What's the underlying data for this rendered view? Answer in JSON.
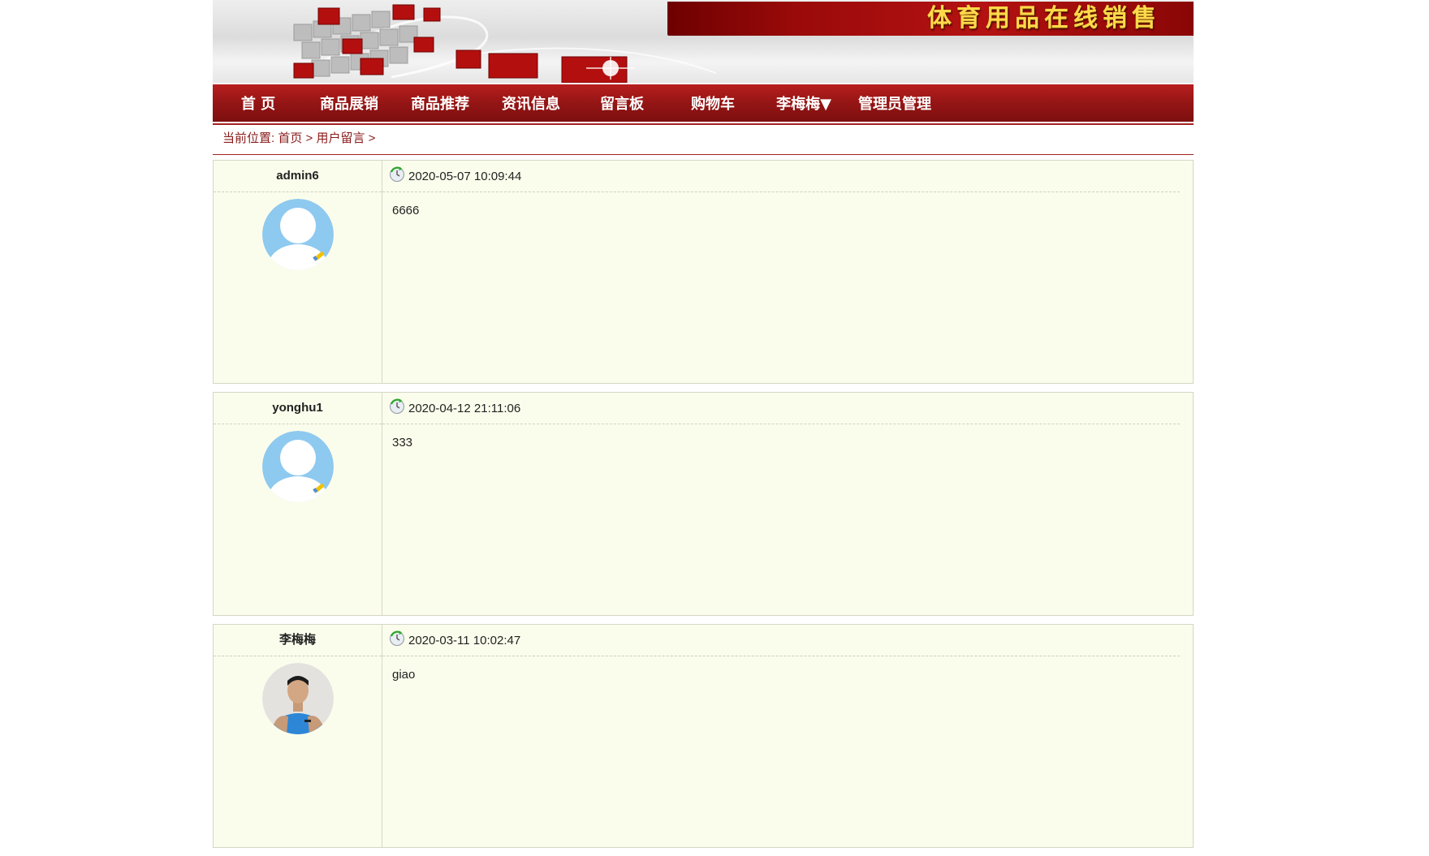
{
  "site": {
    "title": "体育用品在线销售"
  },
  "nav": {
    "items": [
      {
        "label": "首 页",
        "name": "nav-home"
      },
      {
        "label": "商品展销",
        "name": "nav-products"
      },
      {
        "label": "商品推荐",
        "name": "nav-recommend"
      },
      {
        "label": "资讯信息",
        "name": "nav-news"
      },
      {
        "label": "留言板",
        "name": "nav-guestbook"
      },
      {
        "label": "购物车",
        "name": "nav-cart"
      },
      {
        "label": "李梅梅▼",
        "name": "nav-user-menu"
      },
      {
        "label": "管理员管理",
        "name": "nav-admin"
      }
    ]
  },
  "breadcrumb": {
    "prefix": "当前位置: ",
    "home": "首页",
    "sep1": " > ",
    "current": "用户留言",
    "sep2": " >"
  },
  "messages": [
    {
      "username": "admin6",
      "time": "2020-05-07 10:09:44",
      "content": "6666",
      "avatar": "default-avatar"
    },
    {
      "username": "yonghu1",
      "time": "2020-04-12 21:11:06",
      "content": "333",
      "avatar": "default-avatar"
    },
    {
      "username": "李梅梅",
      "time": "2020-03-11 10:02:47",
      "content": "giao",
      "avatar": "photo-avatar"
    }
  ],
  "colors": {
    "primary": "#951515",
    "banner_text": "#ffd94a",
    "message_bg": "#fbfdec",
    "avatar_default": "#8ec9ef"
  },
  "icons": {
    "time": "clock-refresh-icon",
    "default_avatar_badge": "pencil-icon"
  }
}
